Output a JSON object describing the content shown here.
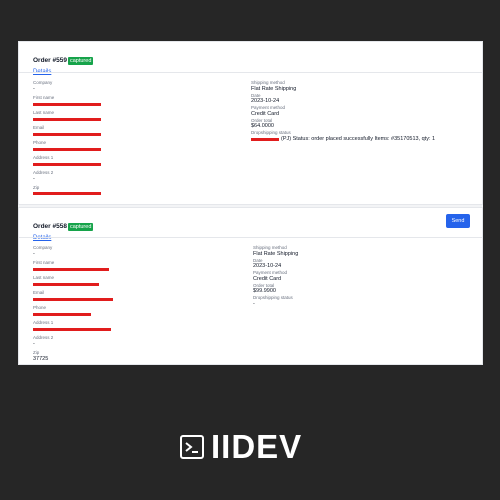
{
  "orders": [
    {
      "title": "Order #559",
      "status_badge": "captured",
      "details_link": "Details",
      "left_fields": [
        {
          "label": "Company",
          "value": "-"
        },
        {
          "label": "First name",
          "value": ""
        },
        {
          "label": "Last name",
          "value": ""
        },
        {
          "label": "Email",
          "value": ""
        },
        {
          "label": "Phone",
          "value": ""
        },
        {
          "label": "Address 1",
          "value": ""
        },
        {
          "label": "Address 2",
          "value": "-"
        },
        {
          "label": "Zip",
          "value": ""
        }
      ],
      "right_fields": [
        {
          "label": "Shipping method",
          "value": "Flat Rate Shipping"
        },
        {
          "label": "Date",
          "value": "2023-10-24"
        },
        {
          "label": "Payment method",
          "value": "Credit Card"
        },
        {
          "label": "Order total",
          "value": "$64.0000"
        },
        {
          "label": "Dropshipping status",
          "value": "(PJ) Status: order placed successfully Items: #35170513, qty: 1"
        }
      ]
    },
    {
      "title": "Order #558",
      "status_badge": "captured",
      "details_link": "Details",
      "send_button": "Send",
      "left_fields": [
        {
          "label": "Company",
          "value": "-"
        },
        {
          "label": "First name",
          "value": ""
        },
        {
          "label": "Last name",
          "value": ""
        },
        {
          "label": "Email",
          "value": ""
        },
        {
          "label": "Phone",
          "value": ""
        },
        {
          "label": "Address 1",
          "value": ""
        },
        {
          "label": "Address 2",
          "value": "-"
        },
        {
          "label": "Zip",
          "value": "37725"
        }
      ],
      "right_fields": [
        {
          "label": "Shipping method",
          "value": "Flat Rate Shipping"
        },
        {
          "label": "Date",
          "value": "2023-10-24"
        },
        {
          "label": "Payment method",
          "value": "Credit Card"
        },
        {
          "label": "Order total",
          "value": "$99.9900"
        },
        {
          "label": "Dropshipping status",
          "value": "-"
        }
      ]
    }
  ],
  "brand": {
    "name": "IIDEV",
    "icon": "terminal-icon"
  },
  "colors": {
    "badge": "#16a34a",
    "link": "#2563eb",
    "redaction": "#e11d1d",
    "background": "#262626"
  }
}
